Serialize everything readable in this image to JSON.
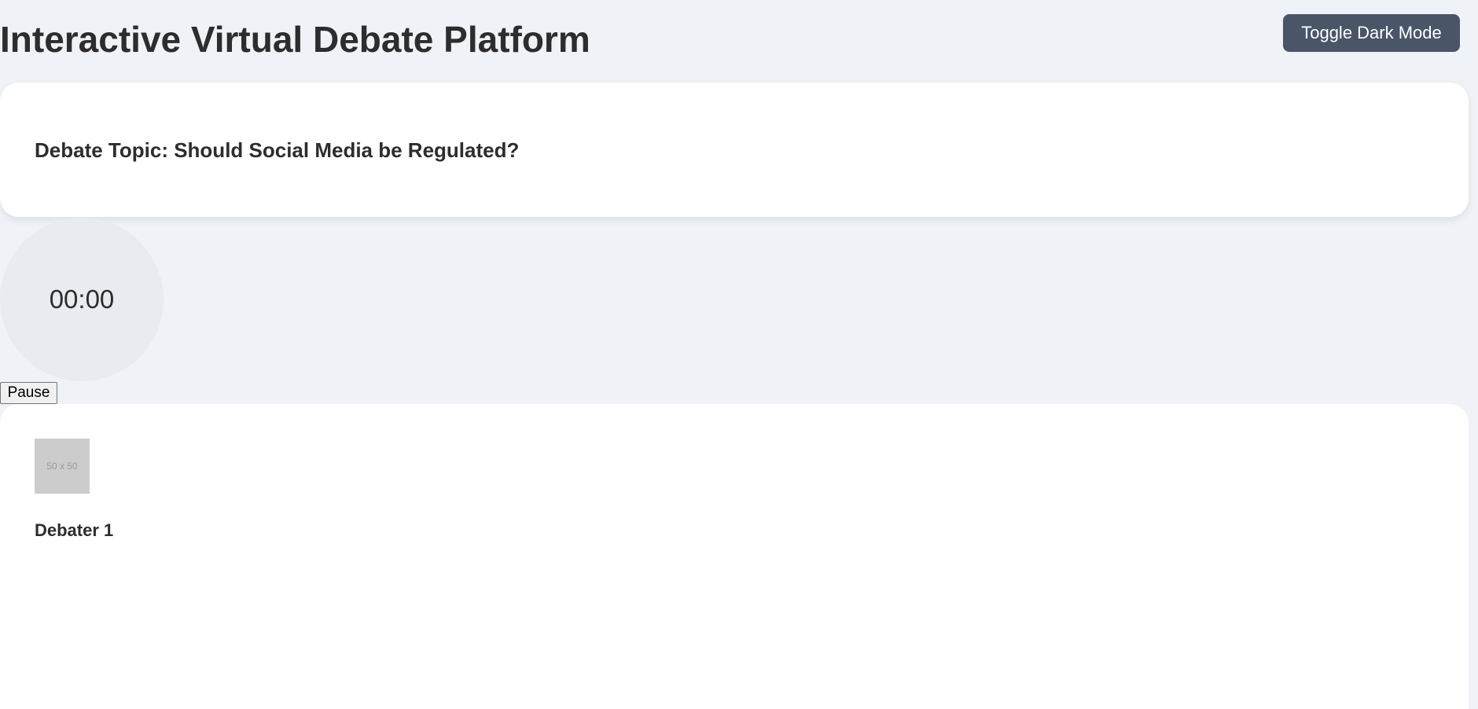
{
  "header": {
    "title": "Interactive Virtual Debate Platform",
    "dark_mode_label": "Toggle Dark Mode"
  },
  "topic": {
    "text": "Debate Topic: Should Social Media be Regulated?"
  },
  "timer": {
    "display": "00:00",
    "pause_label": "Pause"
  },
  "debaters": [
    {
      "avatar_placeholder": "50 x 50",
      "name": "Debater 1"
    }
  ],
  "colors": {
    "background": "#eff2f7",
    "card": "#ffffff",
    "button": "#4a5568",
    "timer_circle": "#e8ebef",
    "avatar_placeholder": "#cccccc"
  }
}
